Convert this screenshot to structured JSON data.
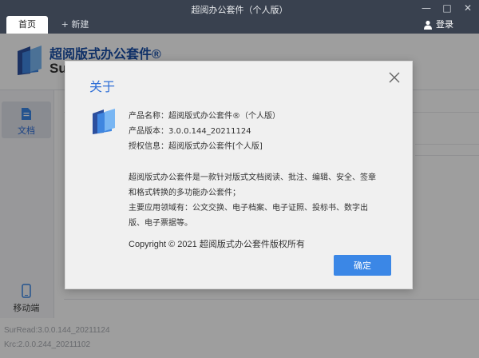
{
  "window": {
    "title": "超阅办公套件（个人版）"
  },
  "tabs": [
    {
      "label": "首页"
    },
    {
      "label": "+ 新建"
    }
  ],
  "account": {
    "login_label": "登录"
  },
  "brand": {
    "name": "超阅版式办公套件®",
    "name_partial": "Su"
  },
  "sidebar": {
    "items": [
      {
        "label": "文档",
        "icon": "document-icon"
      },
      {
        "label": "移动端",
        "icon": "mobile-icon"
      }
    ]
  },
  "versions": {
    "surread": "SurRead:3.0.0.144_20211124",
    "krc": "Krc:2.0.0.244_20211102"
  },
  "dialog": {
    "title": "关于",
    "product_name": "产品名称：超阅版式办公套件®（个人版）",
    "product_version": "产品版本：3.0.0.144_20211124",
    "license": "授权信息：超阅版式办公套件[个人版]",
    "desc_line1": "超阅版式办公套件是一款针对版式文档阅读、批注、编辑、安全、签章",
    "desc_line2": "和格式转换的多功能办公套件；",
    "desc_line3": "主要应用领域有：公文交换、电子档案、电子证照、投标书、数字出",
    "desc_line4": "版、电子票据等。",
    "copyright": "Copyright © 2021 超阅版式办公套件版权所有",
    "ok_label": "确定"
  },
  "colors": {
    "titlebar": "#39414f",
    "accent": "#3b87e6",
    "brand_blue": "#1a4fa8",
    "dialog_bg": "#f0f0f0"
  }
}
